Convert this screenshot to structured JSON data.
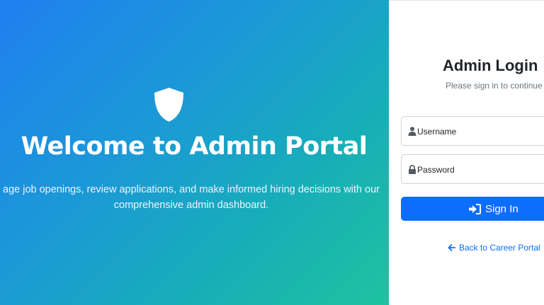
{
  "colors": {
    "gradient_start": "#1f7ff0",
    "gradient_end": "#1fc2a0",
    "primary": "#0d6efd",
    "title_text": "#212529",
    "muted_text": "#6c757d"
  },
  "hero": {
    "icon": "shield-icon",
    "title": "Welcome to Admin Portal",
    "description_line1": "age job openings, review applications, and make informed hiring decisions with our",
    "description_line2": "comprehensive admin dashboard."
  },
  "login": {
    "title": "Admin Login",
    "subtitle": "Please sign in to continue",
    "username": {
      "icon": "user-icon",
      "label": "Username"
    },
    "password": {
      "icon": "lock-icon",
      "label": "Password"
    },
    "submit": {
      "icon": "sign-in-icon",
      "label": "Sign In"
    },
    "back_link": {
      "icon": "arrow-left-icon",
      "label": "Back to Career Portal"
    }
  }
}
